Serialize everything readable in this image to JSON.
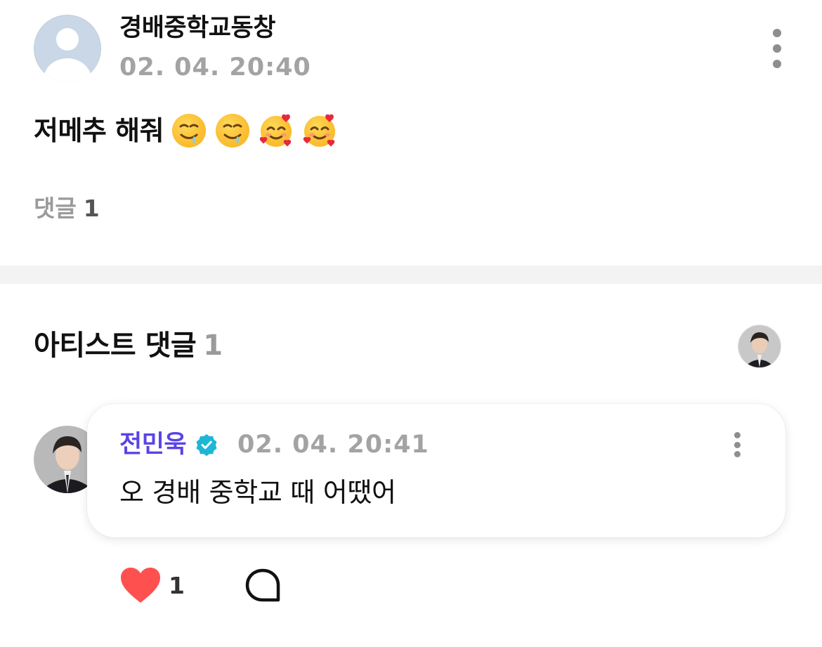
{
  "post": {
    "author": "경배중학교동창",
    "time": "02. 04. 20:40",
    "body_text": "저메추 해줘",
    "emojis": [
      "drooling-face",
      "drooling-face",
      "smiling-face-with-hearts",
      "smiling-face-with-hearts"
    ],
    "comments_label": "댓글",
    "comments_count": "1"
  },
  "artist_comments": {
    "title": "아티스트 댓글",
    "count": "1",
    "comment": {
      "author": "전민욱",
      "verified": true,
      "time": "02. 04. 20:41",
      "body": "오 경배 중학교 때 어땠어",
      "likes": "1"
    }
  },
  "colors": {
    "artist_name": "#5a44e6",
    "verified_badge": "#1fb6d6",
    "heart": "#ff5050",
    "muted_text": "#a3a3a3",
    "divider": "#f3f3f3"
  },
  "icons": {
    "post_more": "kebab-vertical-icon",
    "comment_more": "kebab-vertical-icon",
    "like": "heart-icon",
    "reply": "speech-bubble-icon",
    "verified": "verified-badge-icon"
  }
}
